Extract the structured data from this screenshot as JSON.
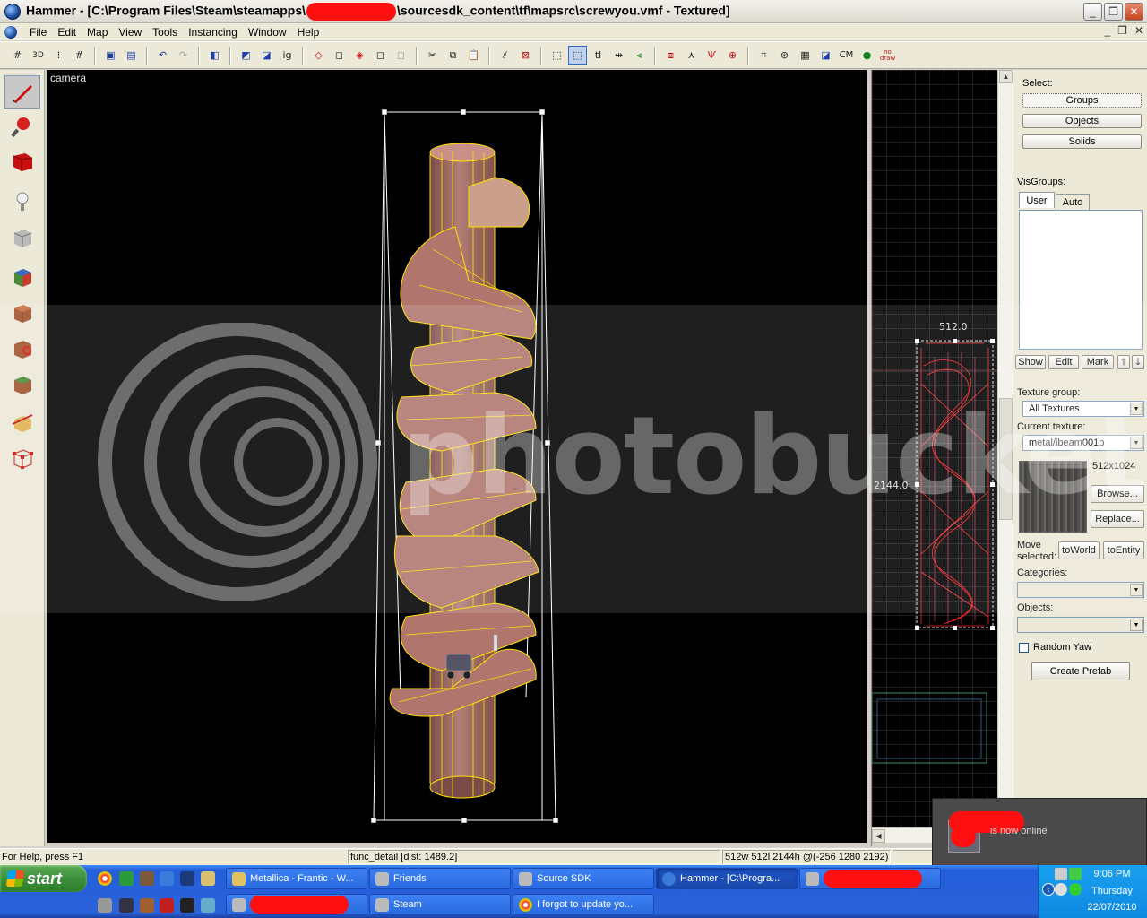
{
  "window": {
    "title_prefix": "Hammer - [C:\\Program Files\\Steam\\steamapps\\",
    "title_suffix": "\\sourcesdk_content\\tf\\mapsrc\\screwyou.vmf - Textured]",
    "minimize": "_",
    "maximize": "❐",
    "close": "✕"
  },
  "menu": [
    "File",
    "Edit",
    "Map",
    "View",
    "Tools",
    "Instancing",
    "Window",
    "Help"
  ],
  "toolbar_icons": [
    "grid-icon",
    "3d-grid-icon",
    "dot-grid-icon",
    "grid-plus-icon",
    "group-icon",
    "ungroup-icon",
    "undo-icon",
    "redo-icon",
    "carve-icon",
    "hollow-icon",
    "texture-lock-icon",
    "cut-icon",
    "copy-icon",
    "paste-icon",
    "select-all-icon",
    "toggle-helpers-icon",
    "measure-icon",
    "load-window-icon",
    "run-map-icon",
    "cordon-icon",
    "no-draw-icon"
  ],
  "toolbar_text": {
    "grid3d": "3D",
    "ig": "ig",
    "tl": "tl",
    "cm": "CM",
    "nodraw": "no draw"
  },
  "tools": [
    "selection-tool",
    "magnify-tool",
    "camera-tool",
    "entity-tool",
    "block-tool",
    "texture-application-tool",
    "apply-current-texture-tool",
    "decal-tool",
    "overlay-tool",
    "clipping-tool",
    "vertex-manipulation-tool"
  ],
  "camera": {
    "label": "camera"
  },
  "grid_view": {
    "width_label": "512.0",
    "height_label": "2144.0"
  },
  "right_panel": {
    "select_label": "Select:",
    "select_buttons": [
      "Groups",
      "Objects",
      "Solids"
    ],
    "visgroups_label": "VisGroups:",
    "visgroup_tabs": [
      "User",
      "Auto"
    ],
    "visgroup_buttons": [
      "Show",
      "Edit",
      "Mark"
    ],
    "texture_group_label": "Texture group:",
    "texture_group_value": "All Textures",
    "current_texture_label": "Current texture:",
    "current_texture_value": "metal/ibeam001b",
    "texture_size": "512x1024",
    "browse": "Browse...",
    "replace": "Replace...",
    "move_selected_label_1": "Move",
    "move_selected_label_2": "selected:",
    "to_world": "toWorld",
    "to_entity": "toEntity",
    "categories_label": "Categories:",
    "objects_label": "Objects:",
    "random_yaw": "Random Yaw",
    "create_prefab": "Create Prefab"
  },
  "status": {
    "help": "For Help, press F1",
    "selection": "func_detail  [dist: 1489.2]",
    "dimensions": "512w 512l 2144h @(-256 1280 2192)"
  },
  "steam_toast": {
    "message": "is now online"
  },
  "taskbar": {
    "start": "start",
    "tasks_row1": [
      {
        "label": "Metallica - Frantic - W...",
        "active": false
      },
      {
        "label": "Friends",
        "active": false
      },
      {
        "label": "Source SDK",
        "active": false
      },
      {
        "label": "Hammer - [C:\\Progra...",
        "active": true
      }
    ],
    "tasks_row2": [
      {
        "label": "Steam"
      },
      {
        "label": "I forgot to update yo..."
      }
    ],
    "time": "9:06 PM",
    "day": "Thursday",
    "date": "22/07/2010"
  },
  "watermark": "photobucket",
  "colors": {
    "brush_face": "#a87068",
    "wire_selected": "#ffe000",
    "bbox": "#ffffff",
    "grid_2d_wire": "#ff2020",
    "redaction": "#ff1010"
  }
}
